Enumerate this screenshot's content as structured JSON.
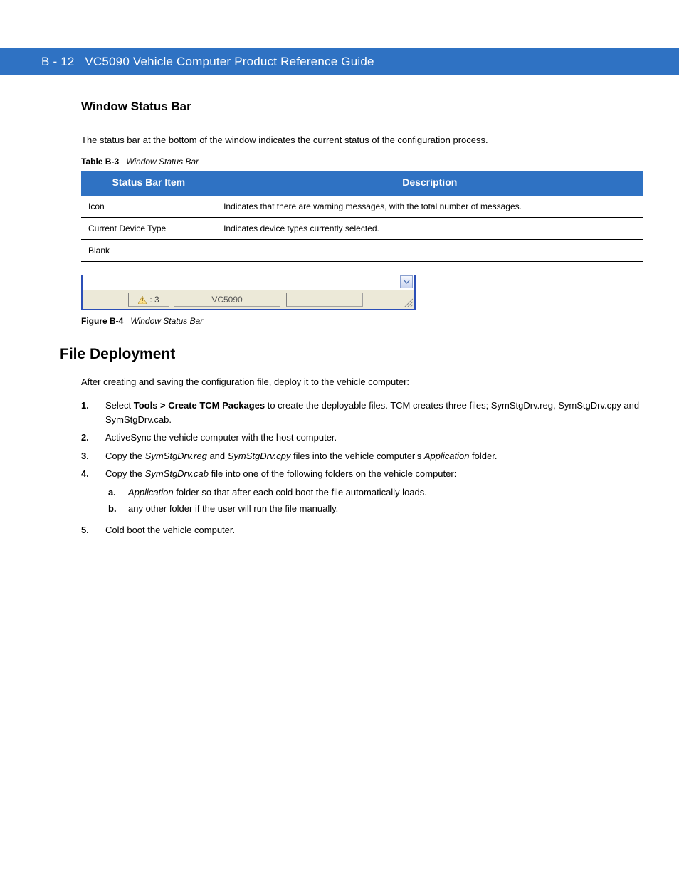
{
  "header": {
    "page_ref": "B - 12",
    "doc_title": "VC5090 Vehicle Computer Product Reference Guide"
  },
  "section": {
    "title": "Window Status Bar",
    "intro": "The status bar at the bottom of the window indicates the current status of the configuration process."
  },
  "table": {
    "label": "Table B-3",
    "caption": "Window Status Bar",
    "col1": "Status Bar Item",
    "col2": "Description",
    "rows": [
      {
        "item": "Icon",
        "desc": "Indicates that there are warning messages, with the total number of messages."
      },
      {
        "item": "Current Device Type",
        "desc": "Indicates device types currently selected."
      },
      {
        "item": "Blank",
        "desc": ""
      }
    ]
  },
  "figure": {
    "warn_count": ": 3",
    "device_type": "VC5090",
    "label": "Figure B-4",
    "caption": "Window Status Bar"
  },
  "deploy": {
    "heading": "File Deployment",
    "intro": "After creating and saving the configuration file, deploy it to the vehicle computer:",
    "steps": [
      {
        "n": "1.",
        "text_before": "Select ",
        "bold": "Tools > Create TCM Packages",
        "text_after": " to create the deployable files. TCM creates three files; SymStgDrv.reg, SymStgDrv.cpy and SymStgDrv.cab."
      },
      {
        "n": "2.",
        "text": "ActiveSync the vehicle computer with the host computer."
      },
      {
        "n": "3.",
        "text_before": "Copy the ",
        "it1": "SymStgDrv.reg",
        "mid1": " and ",
        "it2": "SymStgDrv.cpy",
        "mid2": " files into the vehicle computer's ",
        "folder": "Application",
        "tail": " folder."
      },
      {
        "n": "4.",
        "text_before": "Copy the ",
        "it1": "SymStgDrv.cab",
        "mid1": " file into one of the following folders on the vehicle computer:",
        "sub": [
          {
            "m": "a.",
            "folder": "Application",
            "tail": " folder so that after each cold boot the file automatically loads."
          },
          {
            "m": "b.",
            "tail_pre": "any other folder if the user will run the file manually."
          }
        ]
      },
      {
        "n": "5.",
        "text": "Cold boot the vehicle computer."
      }
    ]
  }
}
